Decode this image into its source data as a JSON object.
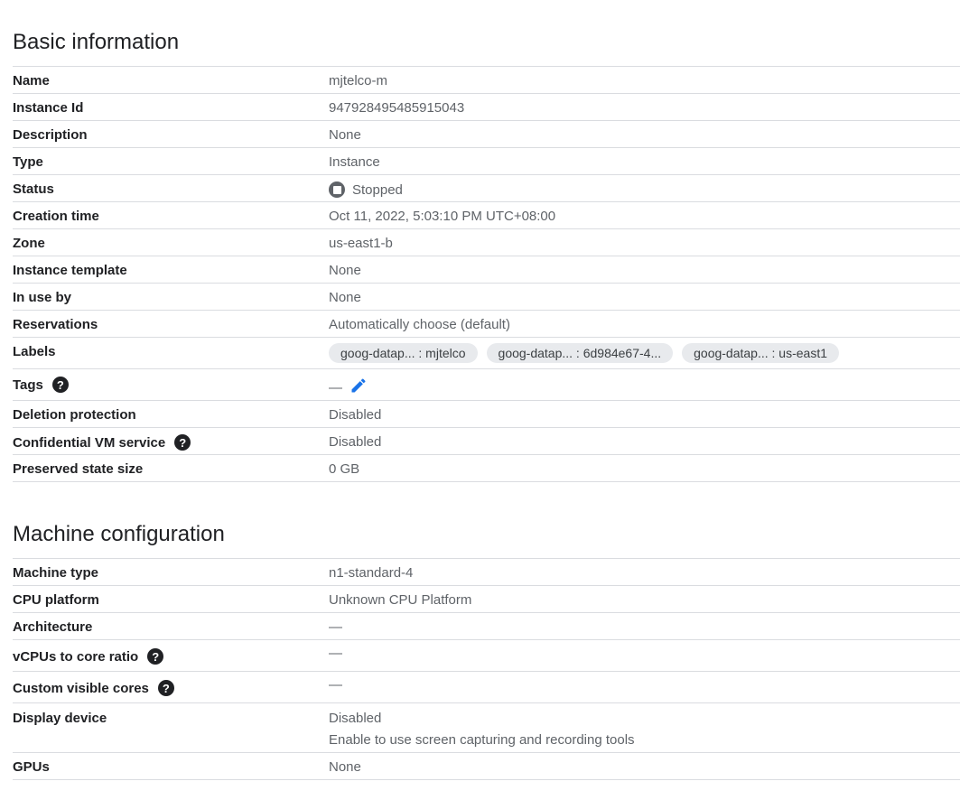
{
  "basic": {
    "title": "Basic information",
    "name": {
      "label": "Name",
      "value": "mjtelco-m"
    },
    "instance_id": {
      "label": "Instance Id",
      "value": "947928495485915043"
    },
    "description": {
      "label": "Description",
      "value": "None"
    },
    "type": {
      "label": "Type",
      "value": "Instance"
    },
    "status": {
      "label": "Status",
      "value": "Stopped"
    },
    "creation_time": {
      "label": "Creation time",
      "value": "Oct 11, 2022, 5:03:10 PM UTC+08:00"
    },
    "zone": {
      "label": "Zone",
      "value": "us-east1-b"
    },
    "instance_template": {
      "label": "Instance template",
      "value": "None"
    },
    "in_use_by": {
      "label": "In use by",
      "value": "None"
    },
    "reservations": {
      "label": "Reservations",
      "value": "Automatically choose (default)"
    },
    "labels": {
      "label": "Labels",
      "chips": [
        "goog-datap... : mjtelco",
        "goog-datap... : 6d984e67-4...",
        "goog-datap... : us-east1"
      ]
    },
    "tags": {
      "label": "Tags",
      "value": "—"
    },
    "deletion_protection": {
      "label": "Deletion protection",
      "value": "Disabled"
    },
    "confidential_vm": {
      "label": "Confidential VM service",
      "value": "Disabled"
    },
    "preserved_state": {
      "label": "Preserved state size",
      "value": "0 GB"
    }
  },
  "machine": {
    "title": "Machine configuration",
    "machine_type": {
      "label": "Machine type",
      "value": "n1-standard-4"
    },
    "cpu_platform": {
      "label": "CPU platform",
      "value": "Unknown CPU Platform"
    },
    "architecture": {
      "label": "Architecture",
      "value": "—"
    },
    "vcpu_ratio": {
      "label": "vCPUs to core ratio",
      "value": "—"
    },
    "custom_cores": {
      "label": "Custom visible cores",
      "value": "—"
    },
    "display_device": {
      "label": "Display device",
      "value": "Disabled",
      "sub": "Enable to use screen capturing and recording tools"
    },
    "gpus": {
      "label": "GPUs",
      "value": "None"
    }
  },
  "colors": {
    "accent": "#1a73e8",
    "text": "#202124",
    "muted": "#5f6368",
    "divider": "#dadce0",
    "chip": "#e8eaed"
  },
  "help_glyph": "?"
}
